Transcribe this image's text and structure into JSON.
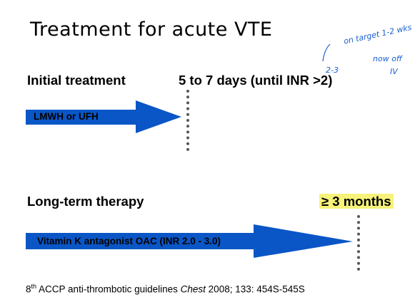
{
  "title": "Treatment for acute VTE",
  "initial": {
    "label": "Initial treatment",
    "duration": "5 to 7 days (until INR >2)",
    "arrow_text": "LMWH or UFH"
  },
  "longterm": {
    "label": "Long-term therapy",
    "duration": "≥ 3  months",
    "arrow_text": "Vitamin K antagonist OAC (INR 2.0 - 3.0)"
  },
  "reference": {
    "ordinal_num": "8",
    "ordinal_suffix": "th",
    "text_before": " ACCP anti-thrombotic guidelines ",
    "journal": "Chest",
    "text_after": " 2008; 133: 454S-545S"
  },
  "handwritten": {
    "line1": "on target 1-2 wks",
    "line2": "2-3",
    "line3": "now off",
    "line4": "IV"
  },
  "colors": {
    "arrow": "#0a56c6",
    "highlight": "#f6f27a",
    "ink": "#1a5fd1"
  }
}
